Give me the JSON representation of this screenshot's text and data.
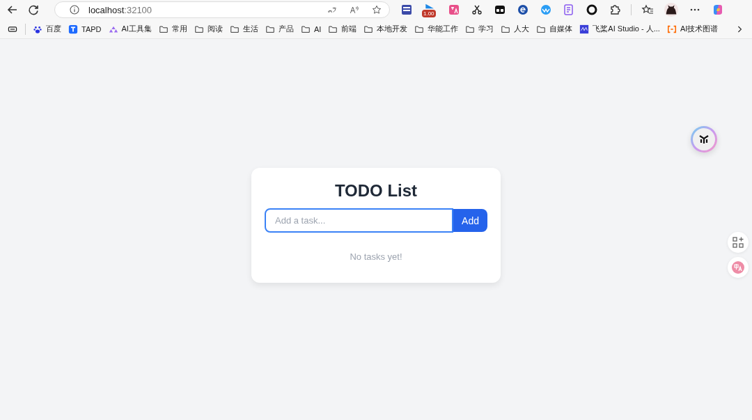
{
  "browser": {
    "address": {
      "host": "localhost",
      "port": ":32100"
    },
    "extension_badge": "1.00",
    "bookmarks": [
      {
        "kind": "baidu",
        "label": "百度"
      },
      {
        "kind": "tapd",
        "label": "TAPD"
      },
      {
        "kind": "ai-tools",
        "label": "AI工具集"
      },
      {
        "kind": "folder",
        "label": "常用"
      },
      {
        "kind": "folder",
        "label": "阅读"
      },
      {
        "kind": "folder",
        "label": "生活"
      },
      {
        "kind": "folder",
        "label": "产品"
      },
      {
        "kind": "folder",
        "label": "AI"
      },
      {
        "kind": "folder",
        "label": "前端"
      },
      {
        "kind": "folder",
        "label": "本地开发"
      },
      {
        "kind": "folder",
        "label": "华能工作"
      },
      {
        "kind": "folder",
        "label": "学习"
      },
      {
        "kind": "folder",
        "label": "人大"
      },
      {
        "kind": "folder",
        "label": "自媒体"
      },
      {
        "kind": "paddle",
        "label": "飞桨AI Studio - 人..."
      },
      {
        "kind": "aitech",
        "label": "AI技术图谱"
      }
    ]
  },
  "todo": {
    "title": "TODO List",
    "input": {
      "placeholder": "Add a task..."
    },
    "add_button": "Add",
    "empty_message": "No tasks yet!"
  }
}
